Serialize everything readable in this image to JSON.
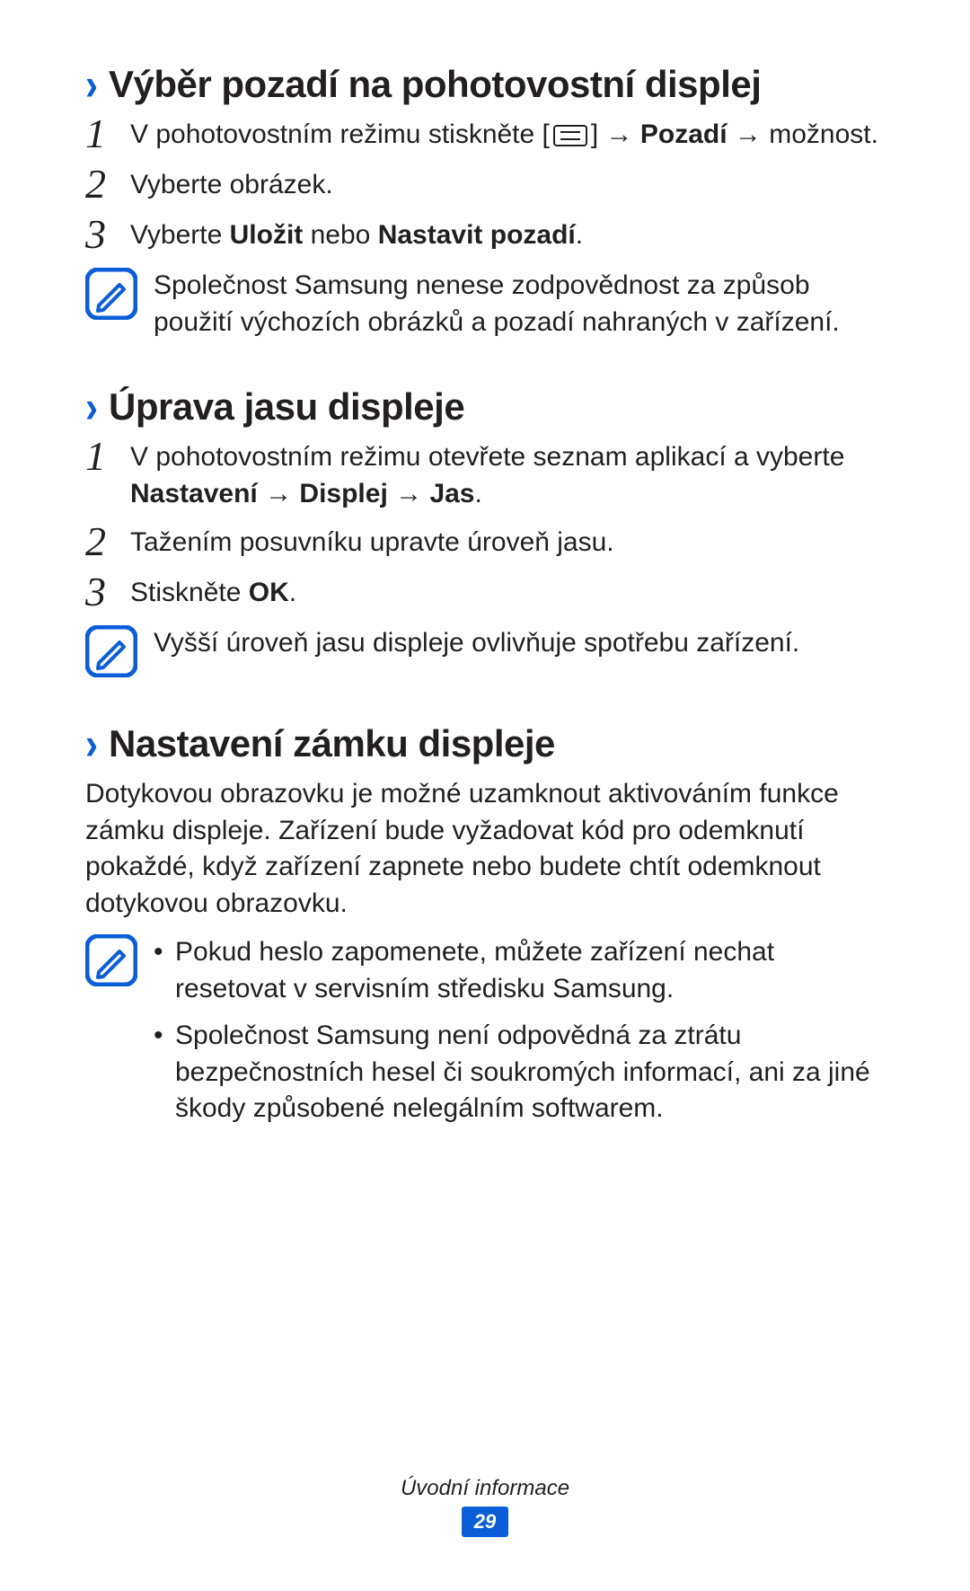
{
  "section1": {
    "heading": "Výběr pozadí na pohotovostní displej",
    "step1_pre": "V pohotovostním režimu stiskněte [",
    "step1_mid": "] → ",
    "step1_bold": "Pozadí",
    "step1_post": " → možnost.",
    "step2": "Vyberte obrázek.",
    "step3_pre": "Vyberte ",
    "step3_bold1": "Uložit",
    "step3_mid": " nebo ",
    "step3_bold2": "Nastavit pozadí",
    "step3_post": ".",
    "note": "Společnost Samsung nenese zodpovědnost za způsob použití výchozích obrázků a pozadí nahraných v zařízení."
  },
  "section2": {
    "heading": "Úprava jasu displeje",
    "step1_pre": "V pohotovostním režimu otevřete seznam aplikací a vyberte ",
    "step1_bold": "Nastavení → Displej → Jas",
    "step1_post": ".",
    "step2": "Tažením posuvníku upravte úroveň jasu.",
    "step3_pre": "Stiskněte ",
    "step3_bold": "OK",
    "step3_post": ".",
    "note": "Vyšší úroveň jasu displeje ovlivňuje spotřebu zařízení."
  },
  "section3": {
    "heading": "Nastavení zámku displeje",
    "para": "Dotykovou obrazovku je možné uzamknout aktivováním funkce zámku displeje. Zařízení bude vyžadovat kód pro odemknutí pokaždé, když zařízení zapnete nebo budete chtít odemknout dotykovou obrazovku.",
    "bul1": "Pokud heslo zapomenete, můžete zařízení nechat resetovat v servisním středisku Samsung.",
    "bul2": "Společnost Samsung není odpovědná za ztrátu bezpečnostních hesel či soukromých informací, ani za jiné škody způsobené nelegálním softwarem."
  },
  "nums": {
    "n1": "1",
    "n2": "2",
    "n3": "3"
  },
  "bullet": "•",
  "chev": "›",
  "footer": {
    "section": "Úvodní informace",
    "page": "29"
  }
}
